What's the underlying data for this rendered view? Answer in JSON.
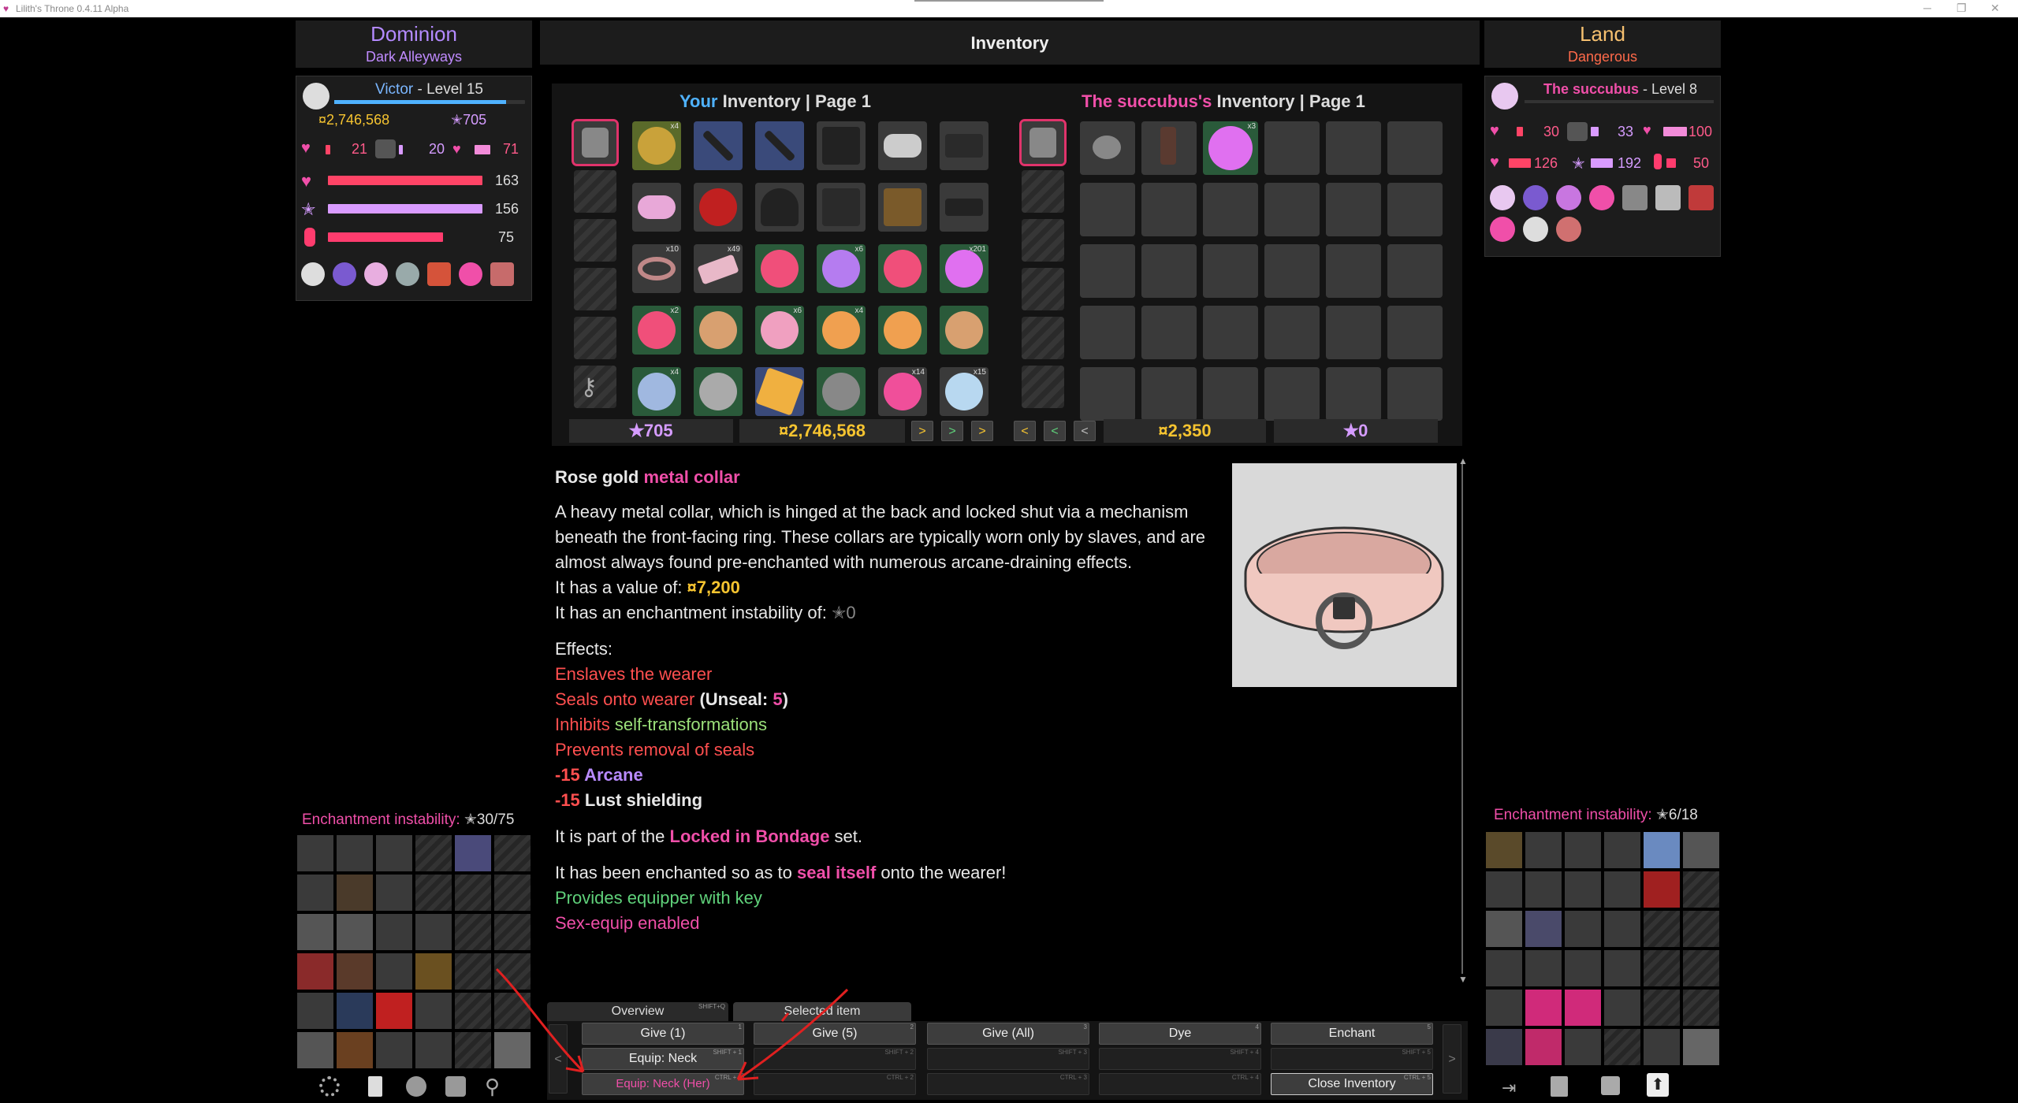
{
  "window": {
    "title": "Lilith's Throne 0.4.11 Alpha",
    "min": "─",
    "max": "❐",
    "close": "✕"
  },
  "left_location": {
    "region": "Dominion",
    "area": "Dark Alleyways"
  },
  "right_location": {
    "region": "Land",
    "area": "Dangerous"
  },
  "header": {
    "title": "Inventory"
  },
  "player": {
    "name": "Victor",
    "level_text": " - Level 15",
    "money": "¤2,746,568",
    "essence": "✭705",
    "res1": "21",
    "res2": "20",
    "res3": "71",
    "health": "163",
    "mana": "156",
    "lust": "75"
  },
  "npc": {
    "name": "The succubus",
    "level_text": " - Level 8",
    "s1": "30",
    "s2": "33",
    "s3": "100",
    "health": "126",
    "mana": "192",
    "lust": "50"
  },
  "player_inv": {
    "owner": "Your",
    "title": " Inventory | Page 1",
    "essence": "✭705",
    "money": "¤2,746,568",
    "arrows": [
      ">",
      ">",
      ">"
    ]
  },
  "npc_inv": {
    "owner": "The succubus's",
    "title": " Inventory | Page 1",
    "money": "¤2,350",
    "essence": "✭0",
    "arrows": [
      "<",
      "<",
      "<"
    ]
  },
  "counts": {
    "c1": "x4",
    "c2": "x10",
    "c3": "x49",
    "c4": "x6",
    "c5": "x201",
    "c6": "x2",
    "c7": "x6",
    "c8": "x4",
    "c9": "x4",
    "c10": "x14",
    "c11": "x15",
    "c12": "x3"
  },
  "item": {
    "name_prefix": "Rose gold ",
    "name": "metal collar",
    "desc": "A heavy metal collar, which is hinged at the back and locked shut via a mechanism beneath the front-facing ring. These collars are typically worn only by slaves, and are almost always found pre-enchanted with numerous arcane-draining effects.",
    "value_label": "It has a value of: ",
    "value": "¤7,200",
    "instab_label": "It has an enchantment instability of: ",
    "instab": "✭0",
    "effects_label": "Effects:",
    "e1": "Enslaves the wearer",
    "e2": "Seals onto wearer",
    "e2b": " (Unseal: ",
    "e2c": "5",
    "e2d": ")",
    "e3a": "Inhibits ",
    "e3b": "self-transformations",
    "e4": "Prevents removal of seals",
    "e5a": "-15 ",
    "e5b": "Arcane",
    "e6a": "-15 ",
    "e6b": "Lust shielding",
    "set_a": "It is part of the ",
    "set_b": "Locked in Bondage",
    "set_c": " set.",
    "ench_a": "It has been enchanted so as to ",
    "ench_b": "seal itself",
    "ench_c": " onto the wearer!",
    "key": "Provides equipper with key",
    "sex": "Sex-equip enabled"
  },
  "left_instab": {
    "label": "Enchantment instability: ",
    "value": "✭30/75"
  },
  "right_instab": {
    "label": "Enchantment instability: ",
    "value": "✭6/18"
  },
  "tabs": {
    "overview": "Overview",
    "overview_key": "SHIFT+Q",
    "selected": "Selected item"
  },
  "actions": {
    "give1": "Give (1)",
    "give5": "Give (5)",
    "giveall": "Give (All)",
    "dye": "Dye",
    "enchant": "Enchant",
    "equip": "Equip: Neck",
    "equip_her": "Equip: Neck (Her)",
    "close": "Close Inventory",
    "prev": "<",
    "next": ">",
    "k1": "1",
    "k2": "2",
    "k3": "3",
    "k4": "4",
    "k5": "5",
    "ks1": "SHIFT + 1",
    "ks2": "SHIFT + 2",
    "ks3": "SHIFT + 3",
    "ks4": "SHIFT + 4",
    "ks5": "SHIFT + 5",
    "kc1": "CTRL + 1",
    "kc2": "CTRL + 2",
    "kc3": "CTRL + 3",
    "kc4": "CTRL + 4",
    "kc5": "CTRL + 5"
  },
  "colors": {
    "pink": "#f04fa9",
    "health": "#ff4466",
    "mana": "#d99bff",
    "lust": "#ff3c6e",
    "xp": "#4fb2ff",
    "essence": "#d59cff",
    "money": "#f6c430"
  }
}
